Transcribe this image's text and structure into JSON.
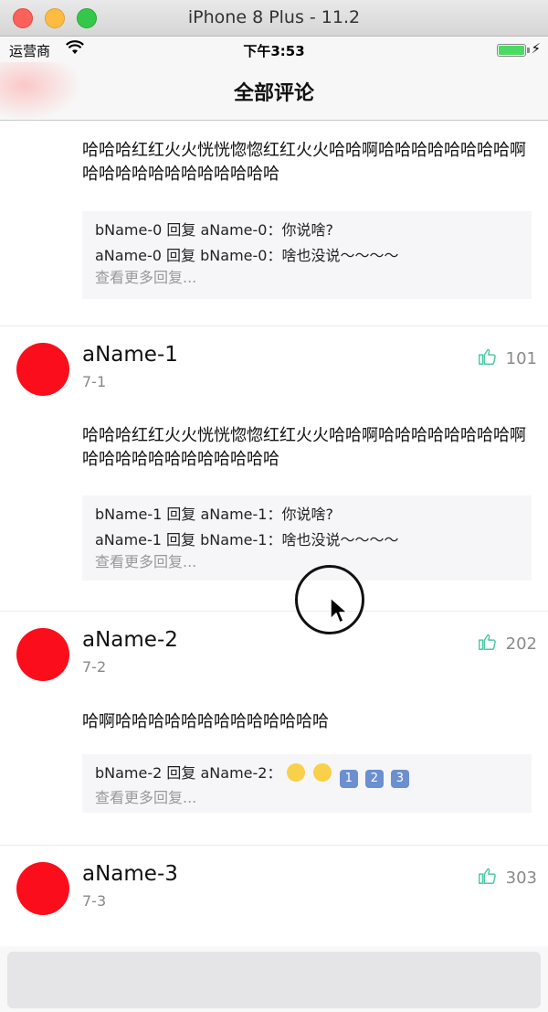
{
  "window": {
    "title": "iPhone 8 Plus - 11.2"
  },
  "statusbar": {
    "carrier": "运营商",
    "time": "下午3:53"
  },
  "nav": {
    "title": "全部评论"
  },
  "colors": {
    "avatar": "#fc0d1b",
    "like_icon": "#4cc9a8"
  },
  "icons": {
    "like": "thumbs-up-icon",
    "wifi": "wifi-icon",
    "battery": "battery-icon",
    "cursor": "mouse-cursor-icon"
  },
  "comments": [
    {
      "body": "哈哈哈红红火火恍恍惚惚红红火火哈哈啊哈哈哈哈哈哈哈哈啊哈哈哈哈哈哈哈哈哈哈哈哈",
      "replies": [
        "bName-0 回复 aName-0：你说啥?",
        "aName-0 回复 bName-0：啥也没说～～～～"
      ],
      "more": "查看更多回复..."
    },
    {
      "name": "aName-1",
      "date": "7-1",
      "likes": "101",
      "body": "哈哈哈红红火火恍恍惚惚红红火火哈哈啊哈哈哈哈哈哈哈哈啊哈哈哈哈哈哈哈哈哈哈哈哈",
      "replies": [
        "bName-1 回复 aName-1：你说啥?",
        "aName-1 回复 bName-1：啥也没说～～～～"
      ],
      "more": "查看更多回复..."
    },
    {
      "name": "aName-2",
      "date": "7-2",
      "likes": "202",
      "body": "哈啊哈哈哈哈哈哈哈哈哈哈哈哈哈",
      "reply_prefix": "bName-2 回复 aName-2：",
      "reply_keycaps": [
        "1",
        "2",
        "3"
      ],
      "more": "查看更多回复..."
    },
    {
      "name": "aName-3",
      "date": "7-3",
      "likes": "303"
    }
  ]
}
